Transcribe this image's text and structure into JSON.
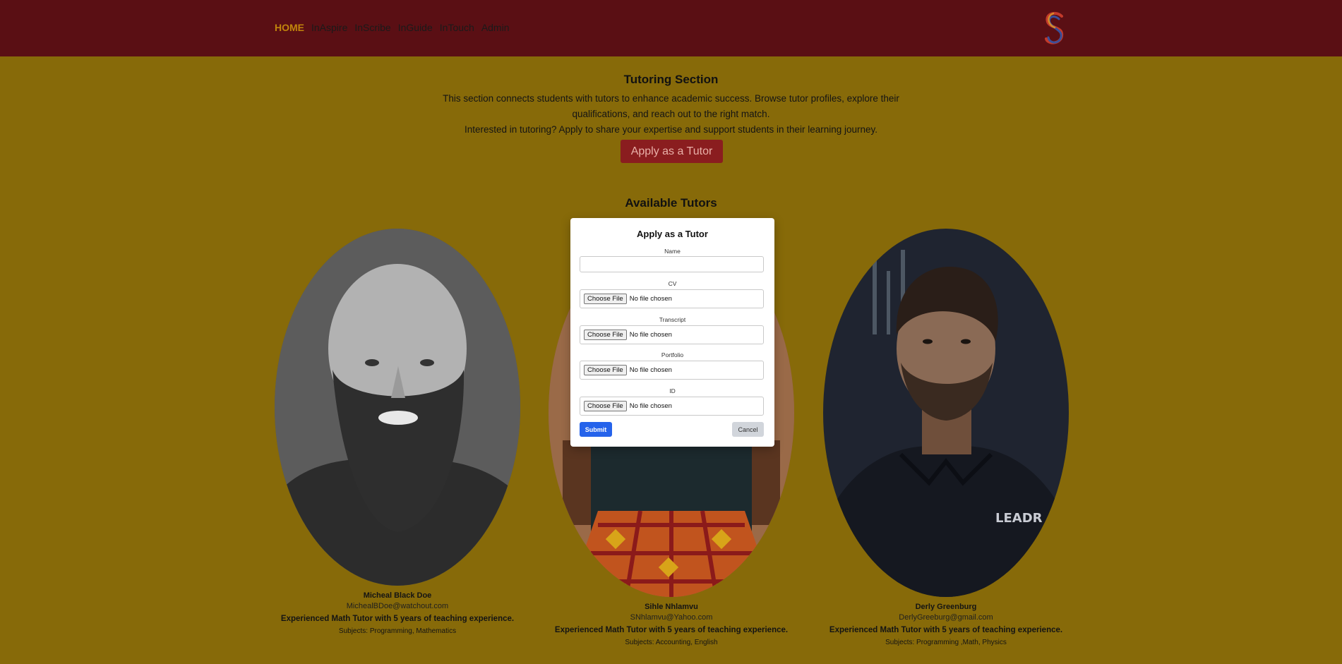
{
  "nav": {
    "items": [
      "HOME",
      "InAspire",
      "InScribe",
      "InGuide",
      "InTouch",
      "Admin"
    ],
    "active_index": 0,
    "logo_icon": "s-logo-icon"
  },
  "intro": {
    "title": "Tutoring Section",
    "text1": "This section connects students with tutors to enhance academic success. Browse tutor profiles, explore their qualifications, and reach out to the right match.",
    "text2": "Interested in tutoring? Apply to share your expertise and support students in their learning journey.",
    "apply_button": "Apply as a Tutor"
  },
  "tutors_section": {
    "title": "Available Tutors",
    "tutors": [
      {
        "name": "Micheal Black Doe",
        "email": "MichealBDoe@watchout.com",
        "description": "Experienced Math Tutor with 5 years of teaching experience.",
        "subjects": "Subjects: Programming, Mathematics"
      },
      {
        "name": "Sihle Nhlamvu",
        "email": "SNhlamvu@Yahoo.com",
        "description": "Experienced Math Tutor with 5 years of teaching experience.",
        "subjects": "Subjects: Accounting, English"
      },
      {
        "name": "Derly Greenburg",
        "email": "DerlyGreeburg@gmail.com",
        "description": "Experienced Math Tutor with 5 years of teaching experience.",
        "subjects": "Subjects: Programming ,Math, Physics",
        "shirt_text": "LEADR"
      }
    ]
  },
  "modal": {
    "title": "Apply as a Tutor",
    "name_label": "Name",
    "name_value": "",
    "file_fields": [
      {
        "label": "CV",
        "button": "Choose File",
        "status": "No file chosen"
      },
      {
        "label": "Transcript",
        "button": "Choose File",
        "status": "No file chosen"
      },
      {
        "label": "Portfolio",
        "button": "Choose File",
        "status": "No file chosen"
      },
      {
        "label": "ID",
        "button": "Choose File",
        "status": "No file chosen"
      }
    ],
    "submit": "Submit",
    "cancel": "Cancel"
  },
  "colors": {
    "header_bg": "#5a0f14",
    "page_bg": "#876a09",
    "active_nav": "#c0850c",
    "apply_button_bg": "#8a1d1f",
    "submit_bg": "#2563eb",
    "cancel_bg": "#d1d5db"
  }
}
